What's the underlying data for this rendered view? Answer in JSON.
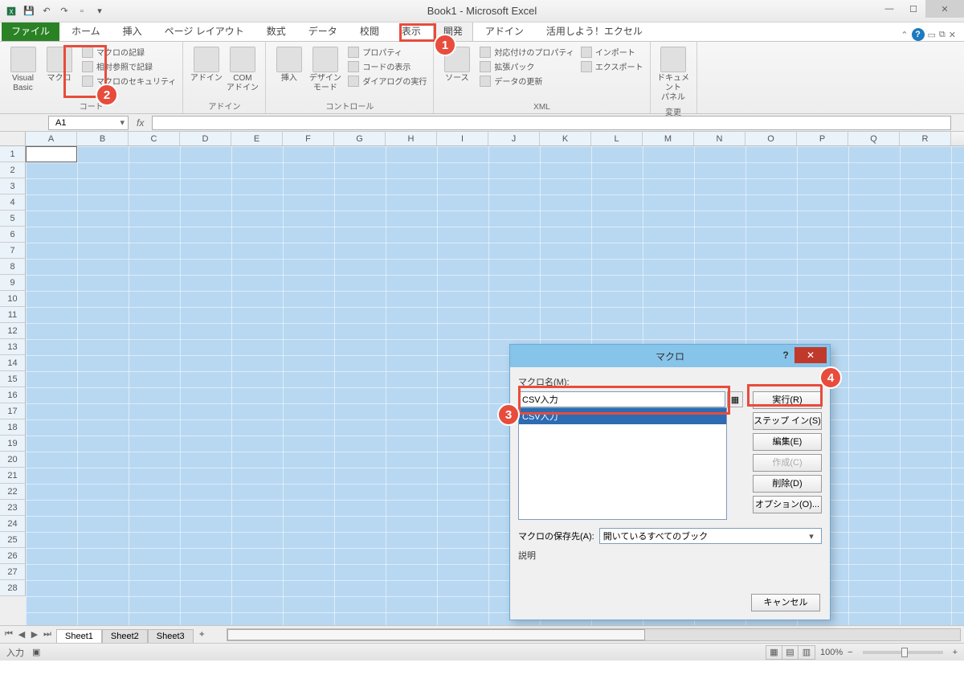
{
  "window": {
    "title": "Book1 - Microsoft Excel"
  },
  "tabs": {
    "file": "ファイル",
    "items": [
      "ホーム",
      "挿入",
      "ページ レイアウト",
      "数式",
      "データ",
      "校閲",
      "表示",
      "開発",
      "アドイン",
      "活用しよう！エクセル"
    ],
    "active": "開発"
  },
  "ribbon": {
    "code": {
      "vba": "Visual Basic",
      "macro": "マクロ",
      "record": "マクロの記録",
      "relref": "相対参照で記録",
      "security": "マクロのセキュリティ",
      "label": "コード"
    },
    "addin": {
      "addin": "アドイン",
      "com": "COM\nアドイン",
      "label": "アドイン"
    },
    "controls": {
      "insert": "挿入",
      "design": "デザイン\nモード",
      "prop": "プロパティ",
      "viewcode": "コードの表示",
      "dialog": "ダイアログの実行",
      "label": "コントロール"
    },
    "xml": {
      "source": "ソース",
      "mapprop": "対応付けのプロパティ",
      "exppack": "拡張パック",
      "refresh": "データの更新",
      "import": "インポート",
      "export": "エクスポート",
      "label": "XML"
    },
    "doc": {
      "panel": "ドキュメント\nパネル",
      "label": "変更"
    }
  },
  "namebox": "A1",
  "columns": [
    "A",
    "B",
    "C",
    "D",
    "E",
    "F",
    "G",
    "H",
    "I",
    "J",
    "K",
    "L",
    "M",
    "N",
    "O",
    "P",
    "Q",
    "R"
  ],
  "rows": [
    "1",
    "2",
    "3",
    "4",
    "5",
    "6",
    "7",
    "8",
    "9",
    "10",
    "11",
    "12",
    "13",
    "14",
    "15",
    "16",
    "17",
    "18",
    "19",
    "20",
    "21",
    "22",
    "23",
    "24",
    "25",
    "26",
    "27",
    "28"
  ],
  "sheets": {
    "active": "Sheet1",
    "s2": "Sheet2",
    "s3": "Sheet3"
  },
  "status": {
    "mode": "入力",
    "zoom": "100%"
  },
  "dialog": {
    "title": "マクロ",
    "name_label": "マクロ名(M):",
    "name_value": "CSV入力",
    "list_selected": "CSV入力",
    "run": "実行(R)",
    "stepin": "ステップ イン(S)",
    "edit": "編集(E)",
    "create": "作成(C)",
    "delete": "削除(D)",
    "options": "オプション(O)...",
    "storage_label": "マクロの保存先(A):",
    "storage_value": "開いているすべてのブック",
    "desc_label": "説明",
    "cancel": "キャンセル"
  },
  "callouts": {
    "1": "1",
    "2": "2",
    "3": "3",
    "4": "4",
    "plus": "+"
  }
}
